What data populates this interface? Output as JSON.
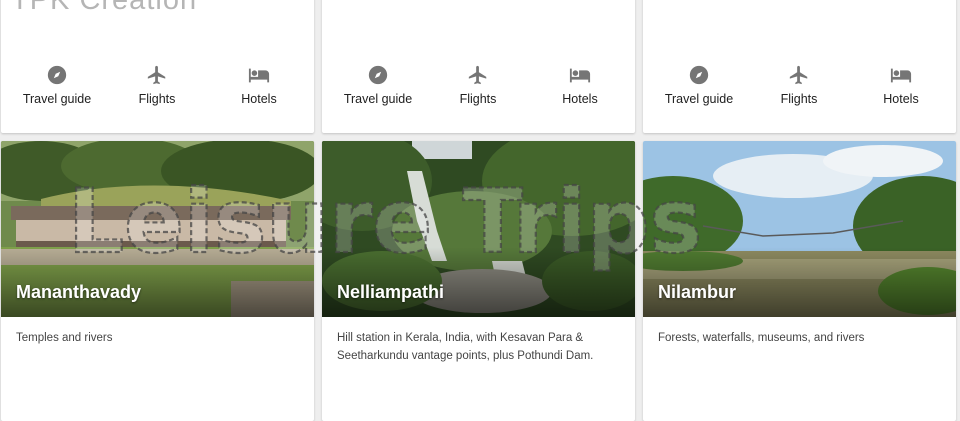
{
  "watermark_top": "TPK Creation",
  "watermark_overlay": "Leisure Trips",
  "actions": {
    "travel_guide": "Travel guide",
    "flights": "Flights",
    "hotels": "Hotels",
    "icons": [
      "compass-icon",
      "plane-icon",
      "bed-icon"
    ]
  },
  "destinations": [
    {
      "name": "Mananthavady",
      "description": "Temples and rivers"
    },
    {
      "name": "Nelliampathi",
      "description": "Hill station in Kerala, India, with Kesavan Para & Seetharkundu vantage points, plus Pothundi Dam."
    },
    {
      "name": "Nilambur",
      "description": "Forests, waterfalls, museums, and rivers"
    }
  ],
  "colors": {
    "card": "#ffffff",
    "background": "#eeeeee",
    "icon": "#757575",
    "text": "#212121"
  }
}
